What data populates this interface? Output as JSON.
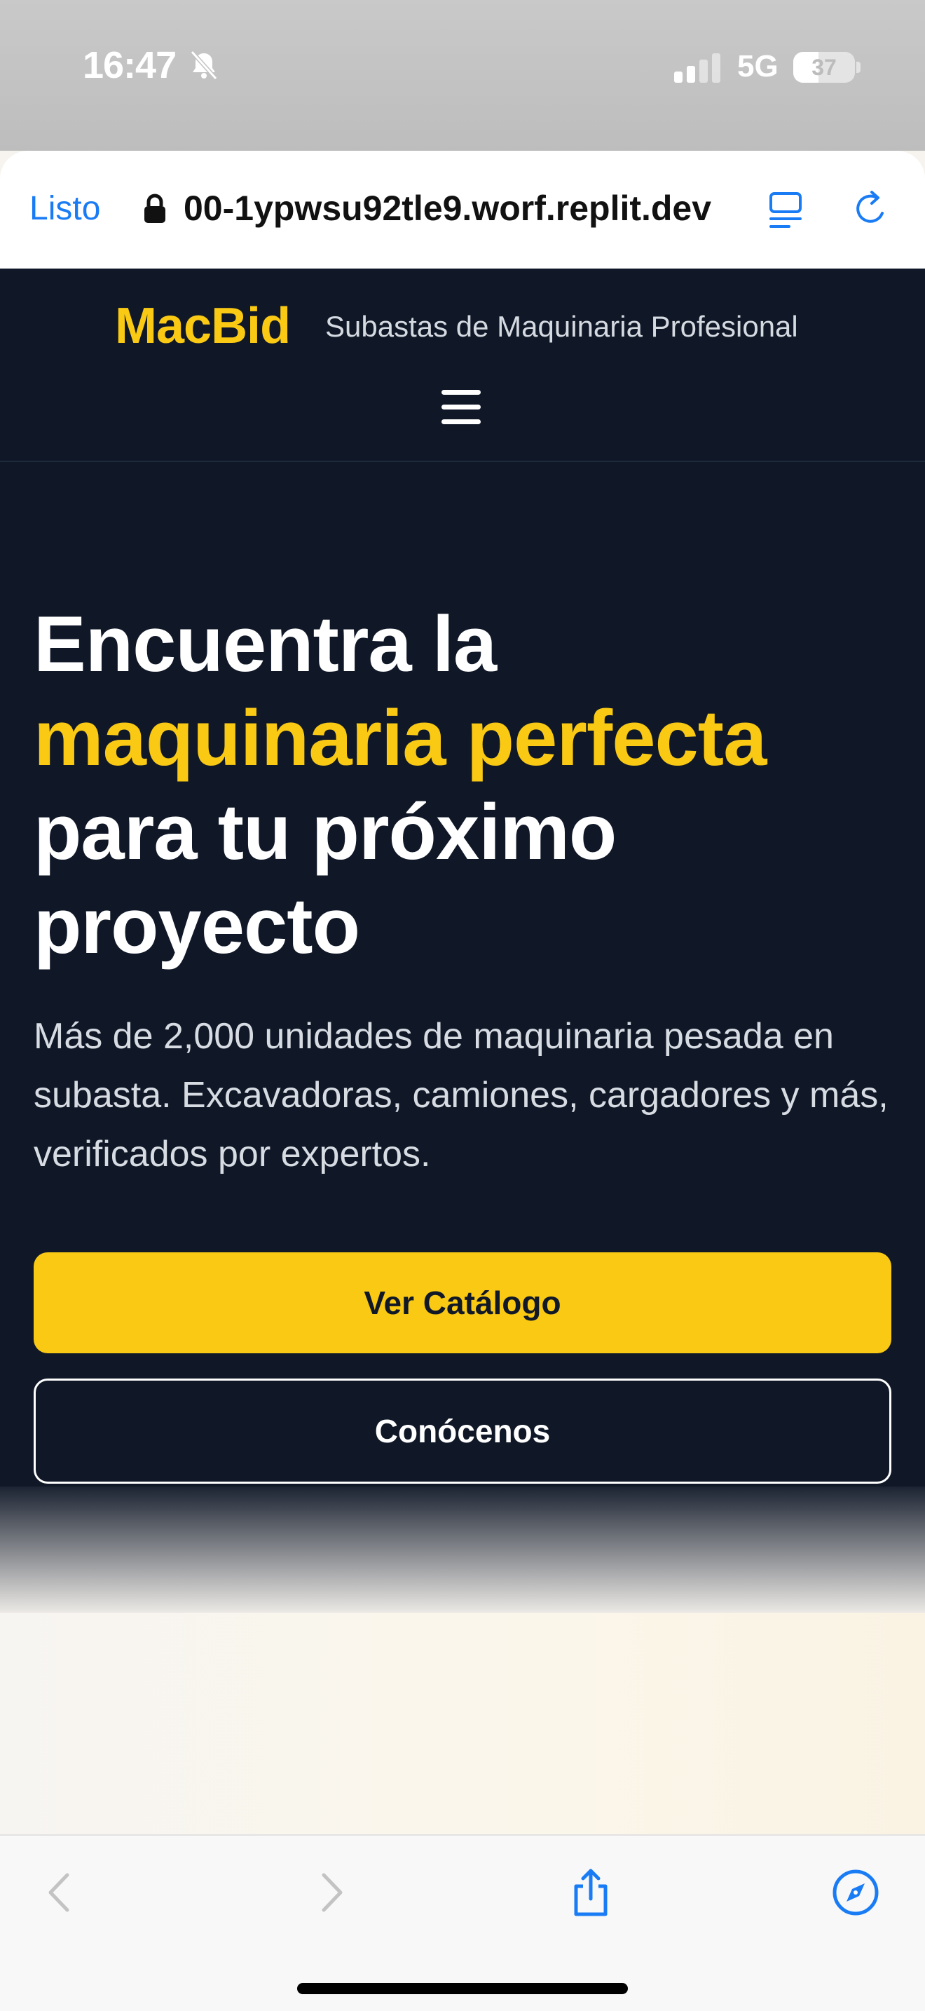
{
  "status": {
    "time": "16:47",
    "network": "5G",
    "battery": "37",
    "battery_level": 0.37
  },
  "browser": {
    "done_label": "Listo",
    "url": "00-1ypwsu92tle9.worf.replit.dev"
  },
  "site": {
    "logo": "MacBid",
    "tagline": "Subastas de Maquinaria Profesional"
  },
  "hero": {
    "title_line1": "Encuentra la",
    "title_highlight": "maquinaria perfecta",
    "title_line3": "para tu próximo",
    "title_line4": "proyecto",
    "subtitle": "Más de 2,000 unidades de maquinaria pesada en subasta. Excavadoras, camiones, cargadores y más, verificados por expertos.",
    "primary_button": "Ver Catálogo",
    "secondary_button": "Conócenos"
  },
  "colors": {
    "accent": "#f9c914",
    "navy": "#101828",
    "link": "#1a7cf5"
  },
  "icons": [
    "bell-muted-icon",
    "signal-icon",
    "battery-icon",
    "lock-icon",
    "reader-icon",
    "reload-icon",
    "hamburger-menu-icon",
    "back-icon",
    "forward-icon",
    "share-icon",
    "compass-icon"
  ]
}
